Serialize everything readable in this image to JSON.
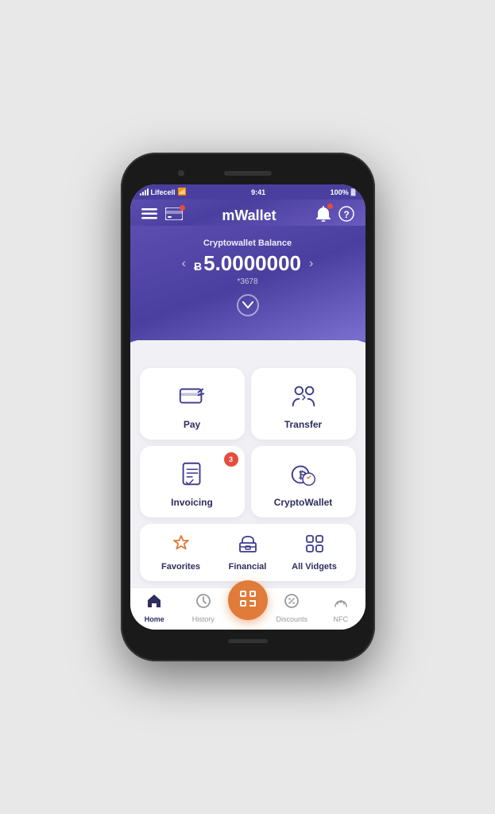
{
  "status_bar": {
    "carrier": "Lifecell",
    "time": "9:41",
    "battery": "100%"
  },
  "header": {
    "title": "mWallet",
    "menu_label": "☰",
    "card_label": "💳",
    "bell_label": "🔔",
    "help_label": "?"
  },
  "balance": {
    "label": "Cryptowallet Balance",
    "currency_symbol": "Ƀ",
    "amount": "5.0000000",
    "account": "*3678",
    "expand_label": "⌄"
  },
  "actions": [
    {
      "id": "pay",
      "label": "Pay",
      "badge": null
    },
    {
      "id": "transfer",
      "label": "Transfer",
      "badge": null
    },
    {
      "id": "invoicing",
      "label": "Invoicing",
      "badge": "3"
    },
    {
      "id": "cryptowallet",
      "label": "CryptoWallet",
      "badge": null
    }
  ],
  "widgets": [
    {
      "id": "favorites",
      "label": "Favorites",
      "type": "star"
    },
    {
      "id": "financial",
      "label": "Financial",
      "type": "bank"
    },
    {
      "id": "all_vidgets",
      "label": "All Vidgets",
      "type": "grid"
    }
  ],
  "bottom_nav": [
    {
      "id": "home",
      "label": "Home",
      "active": true
    },
    {
      "id": "history",
      "label": "History",
      "active": false
    },
    {
      "id": "scan",
      "label": "",
      "active": false,
      "center": true
    },
    {
      "id": "discounts",
      "label": "Discounts",
      "active": false
    },
    {
      "id": "nfc",
      "label": "NFC",
      "active": false
    }
  ],
  "colors": {
    "primary": "#4a3f9f",
    "accent": "#e07b39",
    "white": "#ffffff",
    "dark": "#2d2d5e"
  }
}
